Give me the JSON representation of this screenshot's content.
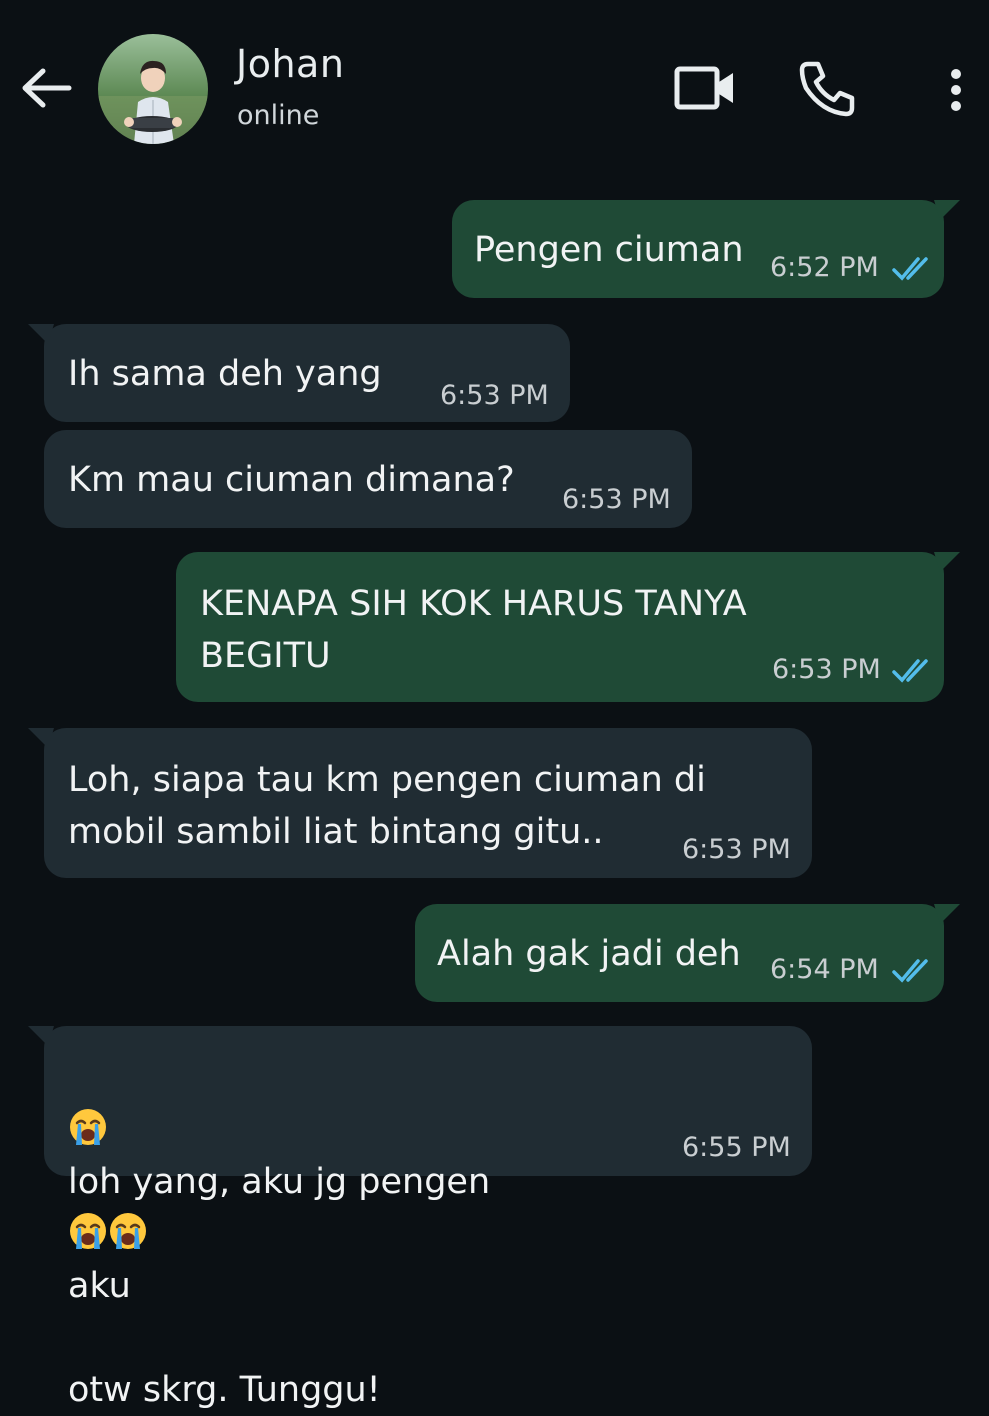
{
  "header": {
    "contact_name": "Johan",
    "contact_status": "online",
    "icons": [
      "back-arrow-icon",
      "avatar-photo",
      "video-call-icon",
      "phone-call-icon",
      "more-vertical-icon"
    ]
  },
  "colors": {
    "background": "#0b1014",
    "outgoing_bubble": "#1f4a36",
    "incoming_bubble": "#202c33",
    "read_ticks": "#53bdeb"
  },
  "messages": [
    {
      "direction": "out",
      "text": "Pengen ciuman",
      "time": "6:52 PM",
      "status": "read"
    },
    {
      "direction": "in",
      "text": "Ih sama deh yang",
      "time": "6:53 PM"
    },
    {
      "direction": "in",
      "text": "Km mau ciuman dimana?",
      "time": "6:53 PM"
    },
    {
      "direction": "out",
      "text": "KENAPA SIH KOK HARUS TANYA\nBEGITU",
      "time": "6:53 PM",
      "status": "read"
    },
    {
      "direction": "in",
      "text": "Loh, siapa tau km pengen ciuman di\nmobil sambil liat bintang gitu..",
      "time": "6:53 PM"
    },
    {
      "direction": "out",
      "text": "Alah gak jadi deh",
      "time": "6:54 PM",
      "status": "read"
    },
    {
      "direction": "in",
      "text_parts": [
        "loh yang, aku jg pengen",
        "aku",
        "otw skrg. Tunggu!"
      ],
      "emoji": "loudly-crying-face",
      "time": "6:55 PM"
    }
  ]
}
